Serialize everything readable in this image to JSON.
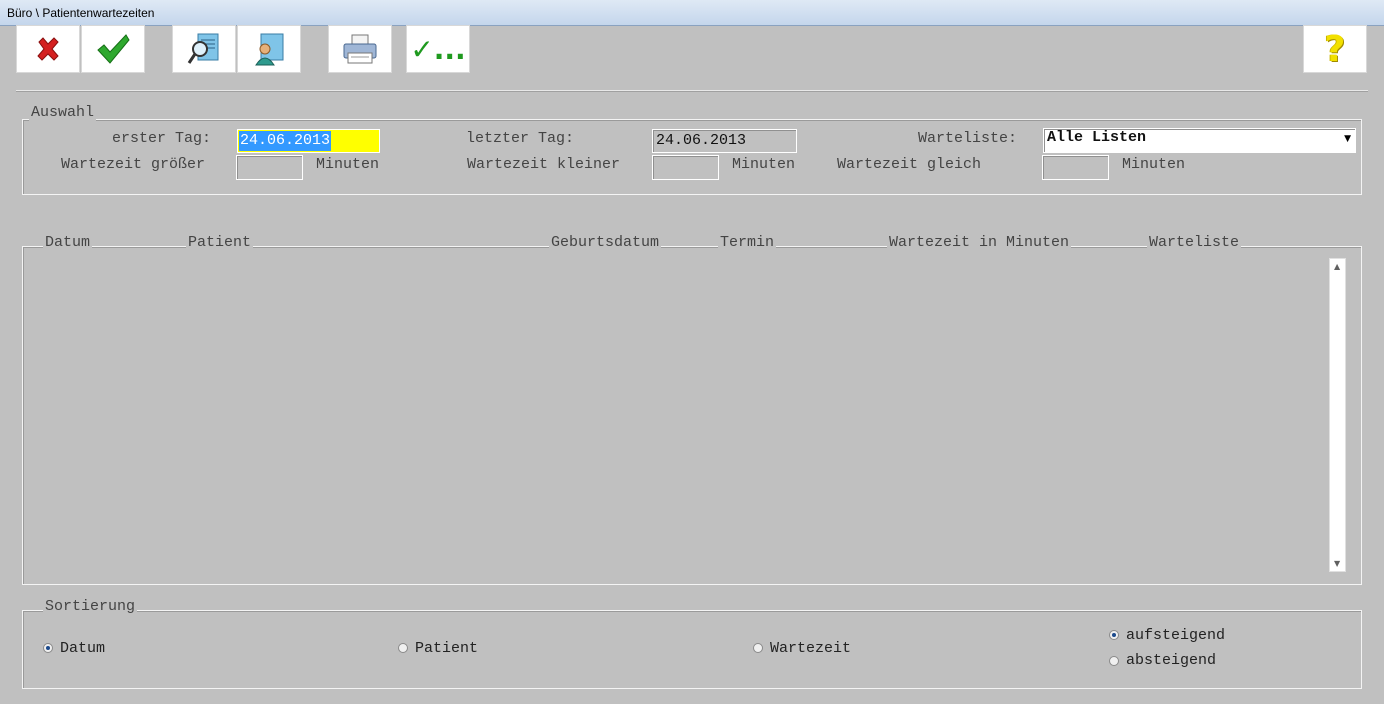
{
  "window": {
    "title": "Büro \\ Patientenwartezeiten"
  },
  "toolbar": {
    "buttons": [
      {
        "name": "cancel",
        "icon": "red-x-icon"
      },
      {
        "name": "ok",
        "icon": "green-check-icon"
      },
      {
        "name": "search",
        "icon": "magnifier-document-icon"
      },
      {
        "name": "patient",
        "icon": "patient-card-icon"
      },
      {
        "name": "print",
        "icon": "printer-icon"
      },
      {
        "name": "select",
        "icon": "check-ellipsis-icon",
        "text": "✓..."
      },
      {
        "name": "help",
        "icon": "question-icon",
        "text": "?"
      }
    ]
  },
  "selection": {
    "legend": "Auswahl",
    "first_day_label": "erster Tag:",
    "first_day_value": "24.06.2013",
    "last_day_label": "letzter Tag:",
    "last_day_value": "24.06.2013",
    "waitlist_label": "Warteliste:",
    "waitlist_value": "Alle Listen",
    "wait_greater_label": "Wartezeit größer",
    "wait_greater_value": "",
    "wait_smaller_label": "Wartezeit kleiner",
    "wait_smaller_value": "",
    "wait_equal_label": "Wartezeit gleich",
    "wait_equal_value": "",
    "minutes_label": "Minuten"
  },
  "table": {
    "columns": [
      "Datum",
      "Patient",
      "Geburtsdatum",
      "Termin",
      "Wartezeit in Minuten",
      "Warteliste"
    ],
    "rows": []
  },
  "sorting": {
    "legend": "Sortierung",
    "options": [
      "Datum",
      "Patient",
      "Wartezeit"
    ],
    "selected": "Datum",
    "order_options": [
      "aufsteigend",
      "absteigend"
    ],
    "order_selected": "aufsteigend"
  },
  "colors": {
    "highlight": "#ffff00",
    "selection": "#3399ff",
    "background": "#c0c0c0"
  }
}
